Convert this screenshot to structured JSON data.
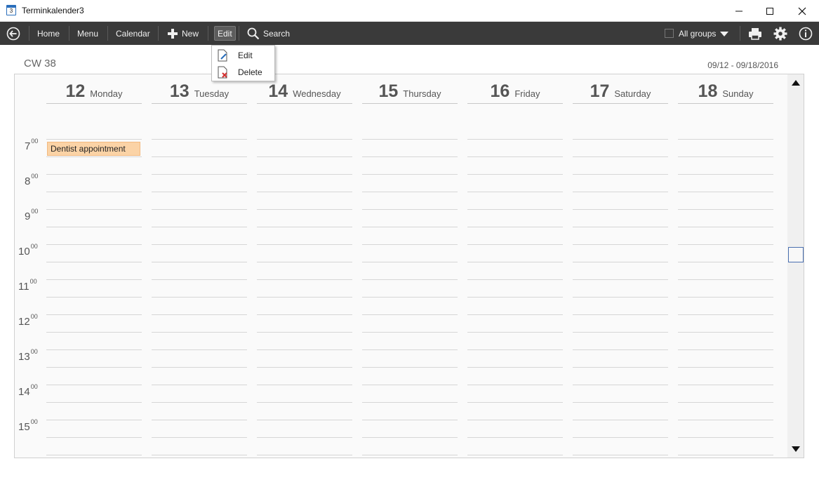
{
  "window": {
    "title": "Terminkalender3",
    "icon_text": "3"
  },
  "toolbar": {
    "home": "Home",
    "menu": "Menu",
    "calendar": "Calendar",
    "new": "New",
    "edit": "Edit",
    "search": "Search",
    "groups": "All groups"
  },
  "edit_menu": {
    "edit": "Edit",
    "delete": "Delete"
  },
  "calendar": {
    "week_label": "CW 38",
    "date_range": "09/12 - 09/18/2016",
    "days": [
      {
        "num": "12",
        "name": "Monday"
      },
      {
        "num": "13",
        "name": "Tuesday"
      },
      {
        "num": "14",
        "name": "Wednesday"
      },
      {
        "num": "15",
        "name": "Thursday"
      },
      {
        "num": "16",
        "name": "Friday"
      },
      {
        "num": "17",
        "name": "Saturday"
      },
      {
        "num": "18",
        "name": "Sunday"
      }
    ],
    "hours": [
      "7",
      "8",
      "9",
      "10",
      "11",
      "12",
      "13",
      "14",
      "15"
    ],
    "minutes_suffix": "00",
    "appointment": {
      "title": "Dentist appointment",
      "day": "Monday",
      "start_hour": "7"
    }
  },
  "colors": {
    "toolbar": "#3a3a3a",
    "appointment": "#fbd3a6",
    "accent": "#2a6ebb"
  }
}
